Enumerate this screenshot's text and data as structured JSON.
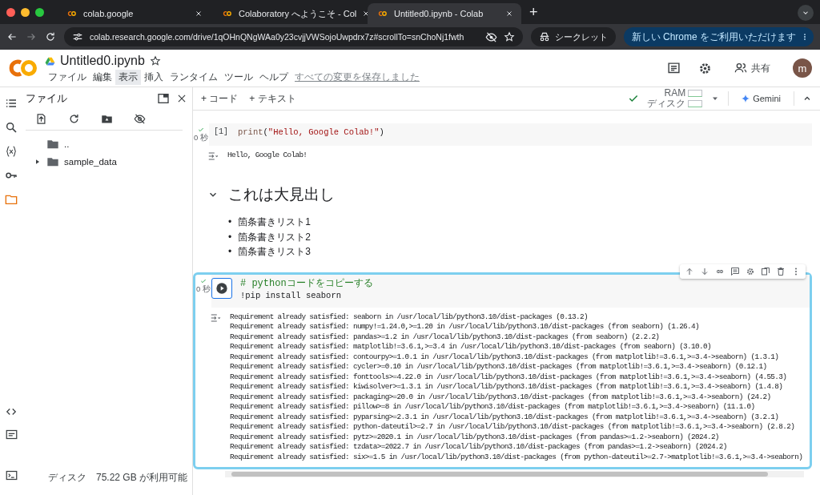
{
  "browser": {
    "tabs": [
      {
        "title": "colab.google",
        "selected": false
      },
      {
        "title": "Colaboratory へようこそ - Col",
        "selected": false
      },
      {
        "title": "Untitled0.ipynb - Colab",
        "selected": true
      }
    ],
    "new_tab": "+",
    "url": "colab.research.google.com/drive/1qOHnQNgWAa0y23cvjjVWSojoUwpdrx7z#scrollTo=snChoNj1fwth",
    "incognito": "シークレット",
    "update_button": "新しい Chrome をご利用いただけます"
  },
  "header": {
    "title": "Untitled0.ipynb",
    "menu": [
      {
        "label": "ファイル",
        "selected": false
      },
      {
        "label": "編集",
        "selected": false
      },
      {
        "label": "表示",
        "selected": true
      },
      {
        "label": "挿入",
        "selected": false
      },
      {
        "label": "ランタイム",
        "selected": false
      },
      {
        "label": "ツール",
        "selected": false
      },
      {
        "label": "ヘルプ",
        "selected": false
      }
    ],
    "save_status": "すべての変更を保存しました",
    "share": "共有",
    "avatar": "m"
  },
  "toolbar": {
    "add_code": "+ コード",
    "add_text": "+ テキスト",
    "ram": "RAM",
    "disk": "ディスク",
    "gemini": "Gemini"
  },
  "rail": [
    {
      "kind": "toc",
      "selected": false
    },
    {
      "kind": "search",
      "selected": false
    },
    {
      "kind": "variables",
      "selected": false
    },
    {
      "kind": "key",
      "selected": false
    },
    {
      "kind": "folder",
      "selected": true
    }
  ],
  "files": {
    "title": "ファイル",
    "tree": [
      {
        "name": "..",
        "kind": "folder"
      },
      {
        "name": "sample_data",
        "kind": "folder",
        "expanded": false
      }
    ],
    "disk_label": "ディスク",
    "disk_free": "75.22 GB が利用可能"
  },
  "cells": [
    {
      "kind": "code",
      "focused": false,
      "exec": "[1]",
      "time": "0 秒",
      "code": [
        [
          {
            "t": "print",
            "kind": "fn"
          },
          {
            "t": "(",
            "kind": "p"
          },
          {
            "t": "\"Hello, Google Colab!\"",
            "kind": "str"
          },
          {
            "t": ")",
            "kind": "p"
          }
        ]
      ],
      "output": [
        "Hello, Google Colab!"
      ]
    },
    {
      "kind": "markdown",
      "heading": "これは大見出し",
      "expanded": true,
      "bullets": [
        {
          "marker": "•",
          "text": "箇条書きリスト1"
        },
        {
          "marker": "•",
          "text": "箇条書きリスト2"
        },
        {
          "marker": "•",
          "text": "箇条書きリスト3"
        }
      ]
    },
    {
      "kind": "code",
      "focused": true,
      "time": "0 秒",
      "code": [
        [
          {
            "t": "# pythonコードをコピーする",
            "kind": "comment"
          }
        ],
        [
          {
            "t": "!pip install seaborn",
            "kind": "p"
          }
        ]
      ],
      "output": [
        "Requirement already satisfied: seaborn in /usr/local/lib/python3.10/dist-packages (0.13.2)",
        "Requirement already satisfied: numpy!=1.24.0,>=1.20 in /usr/local/lib/python3.10/dist-packages (from seaborn) (1.26.4)",
        "Requirement already satisfied: pandas>=1.2 in /usr/local/lib/python3.10/dist-packages (from seaborn) (2.2.2)",
        "Requirement already satisfied: matplotlib!=3.6.1,>=3.4 in /usr/local/lib/python3.10/dist-packages (from seaborn) (3.10.0)",
        "Requirement already satisfied: contourpy>=1.0.1 in /usr/local/lib/python3.10/dist-packages (from matplotlib!=3.6.1,>=3.4->seaborn) (1.3.1)",
        "Requirement already satisfied: cycler>=0.10 in /usr/local/lib/python3.10/dist-packages (from matplotlib!=3.6.1,>=3.4->seaborn) (0.12.1)",
        "Requirement already satisfied: fonttools>=4.22.0 in /usr/local/lib/python3.10/dist-packages (from matplotlib!=3.6.1,>=3.4->seaborn) (4.55.3)",
        "Requirement already satisfied: kiwisolver>=1.3.1 in /usr/local/lib/python3.10/dist-packages (from matplotlib!=3.6.1,>=3.4->seaborn) (1.4.8)",
        "Requirement already satisfied: packaging>=20.0 in /usr/local/lib/python3.10/dist-packages (from matplotlib!=3.6.1,>=3.4->seaborn) (24.2)",
        "Requirement already satisfied: pillow>=8 in /usr/local/lib/python3.10/dist-packages (from matplotlib!=3.6.1,>=3.4->seaborn) (11.1.0)",
        "Requirement already satisfied: pyparsing>=2.3.1 in /usr/local/lib/python3.10/dist-packages (from matplotlib!=3.6.1,>=3.4->seaborn) (3.2.1)",
        "Requirement already satisfied: python-dateutil>=2.7 in /usr/local/lib/python3.10/dist-packages (from matplotlib!=3.6.1,>=3.4->seaborn) (2.8.2)",
        "Requirement already satisfied: pytz>=2020.1 in /usr/local/lib/python3.10/dist-packages (from pandas>=1.2->seaborn) (2024.2)",
        "Requirement already satisfied: tzdata>=2022.7 in /usr/local/lib/python3.10/dist-packages (from pandas>=1.2->seaborn) (2024.2)",
        "Requirement already satisfied: six>=1.5 in /usr/local/lib/python3.10/dist-packages (from python-dateutil>=2.7->matplotlib!=3.6.1,>=3.4->seaborn)"
      ]
    }
  ]
}
